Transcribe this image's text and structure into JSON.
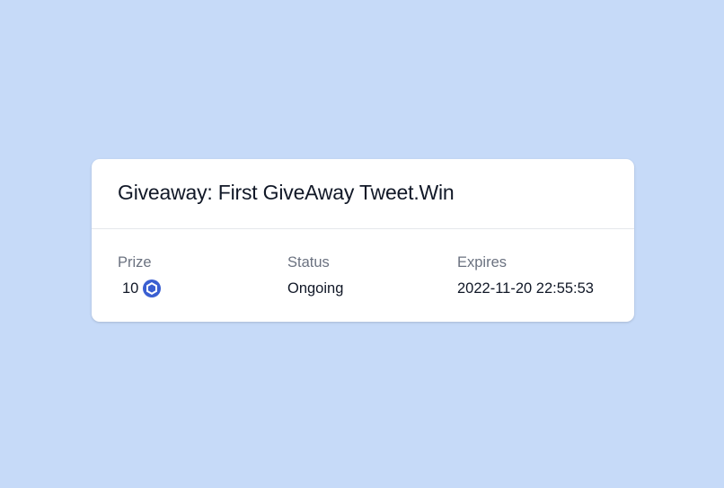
{
  "colors": {
    "background": "#c6daf8",
    "card": "#ffffff",
    "token": "#3a5fd1"
  },
  "giveaway": {
    "title": "Giveaway: First GiveAway Tweet.Win",
    "prize": {
      "label": "Prize",
      "amount": "10",
      "token_icon": "token-coin-icon"
    },
    "status": {
      "label": "Status",
      "value": "Ongoing"
    },
    "expires": {
      "label": "Expires",
      "value": "2022-11-20 22:55:53"
    }
  }
}
